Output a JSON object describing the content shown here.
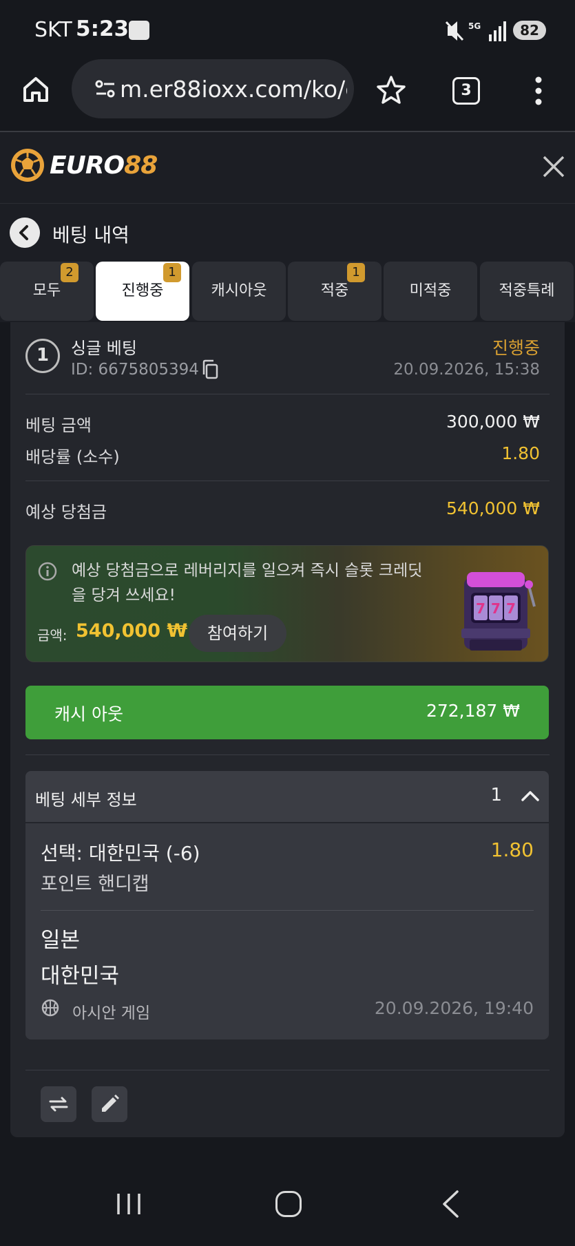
{
  "status_bar": {
    "carrier": "SKT",
    "time": "5:23",
    "battery": "82"
  },
  "browser": {
    "url": "m.er88ioxx.com/ko/c",
    "tab_count": "3"
  },
  "app": {
    "logo_prefix": "EURO",
    "logo_suffix": "88"
  },
  "page": {
    "title": "베팅 내역"
  },
  "tabs": [
    {
      "label": "모두",
      "badge": "2"
    },
    {
      "label": "진행중",
      "badge": "1",
      "active": true
    },
    {
      "label": "캐시아웃",
      "badge": ""
    },
    {
      "label": "적중",
      "badge": "1"
    },
    {
      "label": "미적중",
      "badge": ""
    },
    {
      "label": "적중특례",
      "badge": ""
    }
  ],
  "bet": {
    "number": "1",
    "type": "싱글 베팅",
    "id": "ID: 6675805394",
    "status": "진행중",
    "date": "20.09.2026, 15:38",
    "stake_label": "베팅 금액",
    "stake_value": "300,000 ₩",
    "odds_label": "배당률 (소수)",
    "odds_value": "1.80",
    "payout_label": "예상 당첨금",
    "payout_value": "540,000 ₩"
  },
  "promo": {
    "text": "예상 당첨금으로 레버리지를 일으켜 즉시 슬롯 크레딧을 당겨 쓰세요!",
    "amount_label": "금액:",
    "amount": "540,000 ₩",
    "join_label": "참여하기"
  },
  "cashout": {
    "label": "캐시 아웃",
    "value": "272,187 ₩"
  },
  "details": {
    "title": "베팅 세부 정보",
    "count": "1",
    "selection": "선택: 대한민국 (-6)",
    "selection_odds": "1.80",
    "market": "포인트 핸디캡",
    "team_home": "일본",
    "team_away": "대한민국",
    "league": "아시안 게임",
    "match_date": "20.09.2026, 19:40"
  },
  "icons": [
    "home-icon",
    "tune-icon",
    "star-icon",
    "more-vert-icon",
    "close-icon",
    "back-icon",
    "copy-icon",
    "info-icon",
    "slot-machine-icon",
    "chevron-up-icon",
    "basketball-icon",
    "swap-icon",
    "edit-icon",
    "nav-recent-icon",
    "nav-home-icon",
    "nav-back-icon"
  ],
  "colors": {
    "accent_gold": "#f1c232",
    "status_orange": "#d9a031",
    "cashout_green": "#3f9e3a",
    "badge": "#d19a2e"
  }
}
